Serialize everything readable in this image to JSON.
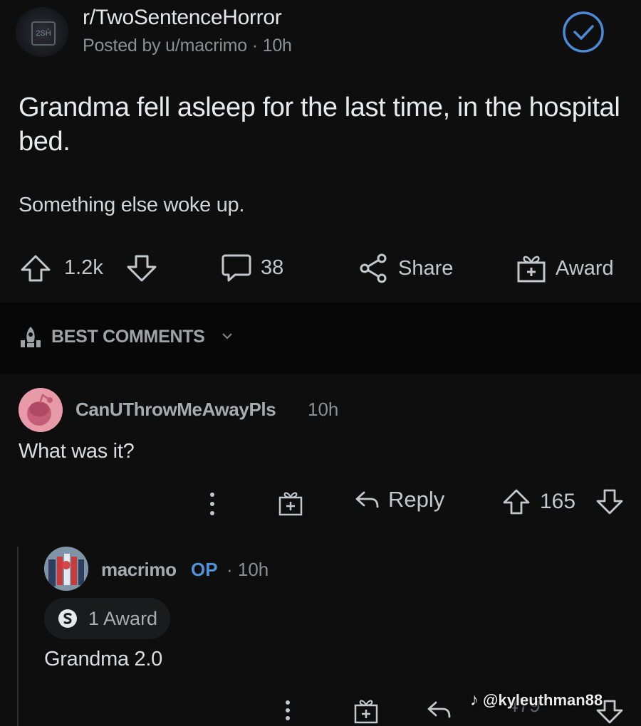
{
  "header": {
    "subreddit": "r/TwoSentenceHorror",
    "meta": "Posted by u/macrimo · 10h",
    "avatar_icon": "subreddit-avatar-icon",
    "avatar_text": "2SĤ"
  },
  "post": {
    "title": "Grandma fell asleep for the last time, in the hospital bed.",
    "body": "Something else woke up.",
    "score": "1.2k",
    "comments_count": "38",
    "share_label": "Share",
    "award_label": "Award"
  },
  "sort": {
    "label": "BEST COMMENTS"
  },
  "comments": [
    {
      "author": "CanUThrowMeAwayPls",
      "time": "10h",
      "body": "What was it?",
      "reply_label": "Reply",
      "score": "165",
      "avatar_color": "#e79aa7"
    },
    {
      "author": "macrimo",
      "op_badge": "OP",
      "time": "· 10h",
      "award_text": "1 Award",
      "body": "Grandma 2.0",
      "score": "479"
    }
  ],
  "watermark": {
    "text": "@kyleuthman88"
  },
  "colors": {
    "background": "#0e0e0f",
    "text": "#d7dadc",
    "muted": "#8b8f94",
    "op_blue": "#4f93d8",
    "check_blue": "#4b8ad6"
  }
}
